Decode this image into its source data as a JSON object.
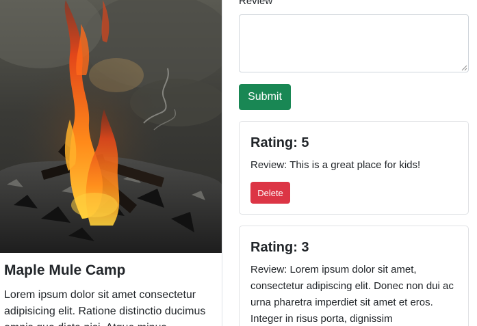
{
  "campground": {
    "image_alt": "campfire-photo",
    "title": "Maple Mule Camp",
    "description": "Lorem ipsum dolor sit amet consectetur adipisicing elit. Ratione distinctio ducimus omnis quo dicta nisi. Atque minus"
  },
  "review_form": {
    "label": "Review",
    "textarea_value": "",
    "submit_label": "Submit"
  },
  "reviews": [
    {
      "rating_label": "Rating: 5",
      "body": "Review: This is a great place for kids!",
      "delete_label": "Delete"
    },
    {
      "rating_label": "Rating: 3",
      "body": "Review: Lorem ipsum dolor sit amet, consectetur adipiscing elit. Donec non dui ac urna pharetra imperdiet sit amet et eros. Integer in risus porta, dignissim",
      "delete_label": "Delete"
    }
  ],
  "colors": {
    "submit": "#198754",
    "delete": "#dc3545",
    "border": "#dee2e6",
    "text": "#212529"
  }
}
